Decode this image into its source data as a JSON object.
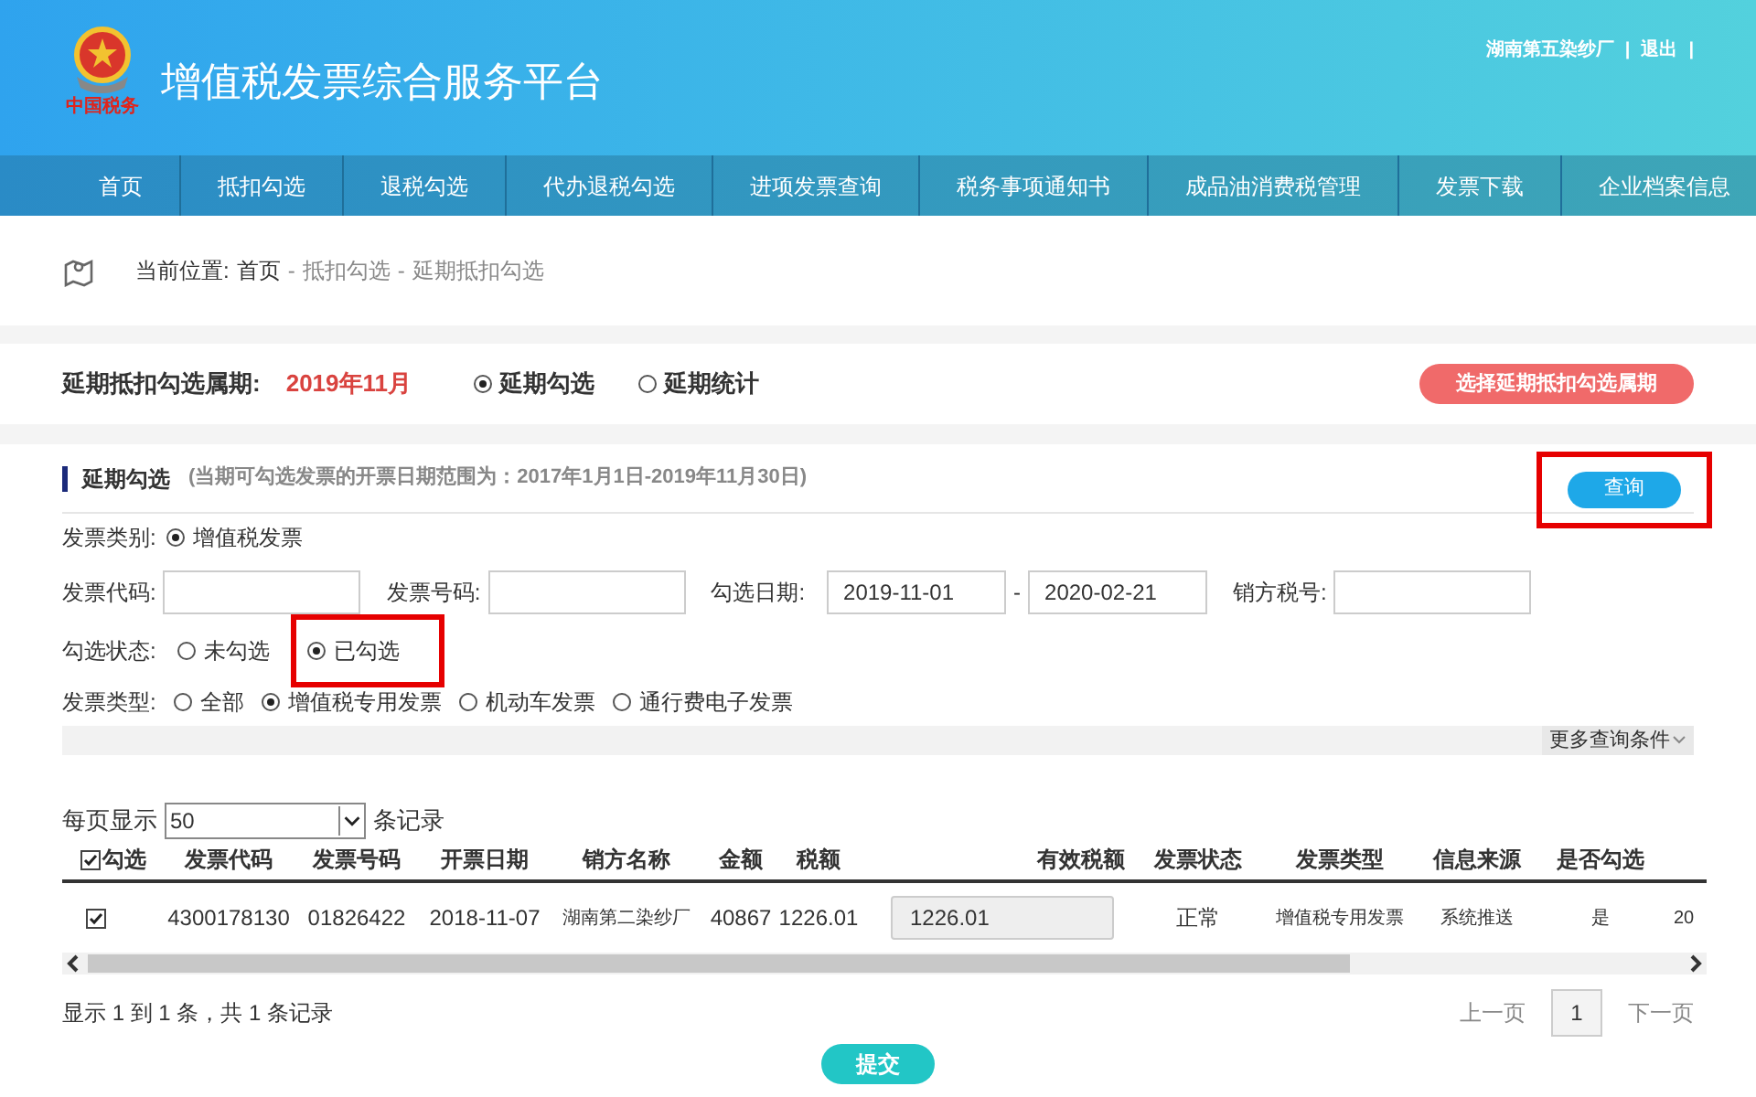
{
  "header": {
    "logo_text": "中国税务",
    "title": "增值税发票综合服务平台",
    "user": "湖南第五染纱厂",
    "logout": "退出",
    "separator": "|"
  },
  "nav": [
    {
      "label": "首页"
    },
    {
      "label": "抵扣勾选"
    },
    {
      "label": "退税勾选"
    },
    {
      "label": "代办退税勾选"
    },
    {
      "label": "进项发票查询"
    },
    {
      "label": "税务事项通知书"
    },
    {
      "label": "成品油消费税管理"
    },
    {
      "label": "发票下载"
    },
    {
      "label": "企业档案信息"
    }
  ],
  "breadcrumb": {
    "label": "当前位置:",
    "items": [
      "首页",
      "抵扣勾选",
      "延期抵扣勾选"
    ],
    "separator": "-"
  },
  "period": {
    "label": "延期抵扣勾选属期:",
    "value": "2019年11月",
    "options": [
      {
        "label": "延期勾选",
        "selected": true
      },
      {
        "label": "延期统计",
        "selected": false
      }
    ],
    "button": "选择延期抵扣勾选属期"
  },
  "section": {
    "title": "延期勾选",
    "note": "(当期可勾选发票的开票日期范围为：2017年1月1日-2019年11月30日)",
    "query_button": "查询",
    "query_highlighted": true
  },
  "filters": {
    "category": {
      "label": "发票类别:",
      "options": [
        {
          "label": "增值税发票",
          "selected": true
        }
      ]
    },
    "fields": [
      {
        "kind": "text",
        "label": "发票代码:"
      },
      {
        "kind": "text",
        "label": "发票号码:"
      },
      {
        "kind": "range",
        "label": "勾选日期:",
        "from": "2019-11-01",
        "separator": "-",
        "to": "2020-02-21"
      },
      {
        "kind": "text",
        "label": "销方税号:"
      }
    ],
    "status": {
      "label": "勾选状态:",
      "options": [
        {
          "label": "未勾选",
          "selected": false,
          "highlighted": false
        },
        {
          "label": "已勾选",
          "selected": true,
          "highlighted": true
        }
      ]
    },
    "type": {
      "label": "发票类型:",
      "options": [
        {
          "label": "全部",
          "selected": false
        },
        {
          "label": "增值税专用发票",
          "selected": true
        },
        {
          "label": "机动车发票",
          "selected": false
        },
        {
          "label": "通行费电子发票",
          "selected": false
        }
      ]
    },
    "more": "更多查询条件"
  },
  "page_size": {
    "label": "每页显示",
    "value": "50",
    "suffix": "条记录"
  },
  "table": {
    "select_all": {
      "label": "勾选",
      "checked": true
    },
    "columns": [
      "发票代码",
      "发票号码",
      "开票日期",
      "销方名称",
      "金额",
      "税额",
      "有效税额",
      "发票状态",
      "发票类型",
      "信息来源",
      "是否勾选"
    ],
    "rows": [
      {
        "checked": true,
        "cells": [
          "4300178130",
          "01826422",
          "2018-11-07",
          "湖南第二染纱厂",
          "40867",
          "1226.01",
          "1226.01",
          "正常",
          "增值税专用发票",
          "系统推送",
          "是",
          "20"
        ]
      }
    ]
  },
  "summary": "显示 1 到 1 条，共 1 条记录",
  "pagination": {
    "prev": "上一页",
    "pages": [
      {
        "label": "1",
        "selected": true
      }
    ],
    "next": "下一页"
  },
  "submit": "提交"
}
